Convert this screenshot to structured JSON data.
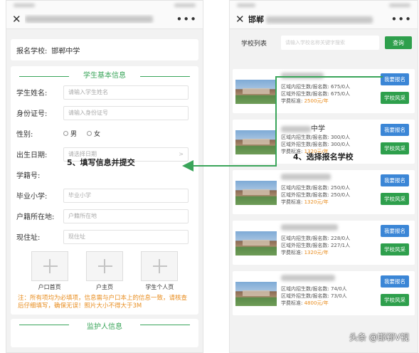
{
  "left_phone": {
    "titlebar": {
      "close_icon": "✕",
      "more_icon": "•••"
    },
    "school_row": {
      "label": "报名学校:",
      "value": "邯郸中学"
    },
    "basic_section_title": "学生基本信息",
    "fields": [
      {
        "label": "学生姓名:",
        "placeholder": "请输入学生姓名"
      },
      {
        "label": "身份证号:",
        "placeholder": "请输入身份证号"
      }
    ],
    "gender": {
      "label": "性别:",
      "options": [
        "男",
        "女"
      ]
    },
    "fields2": [
      {
        "label": "出生日期:",
        "placeholder": "请选择日期"
      },
      {
        "label": "学籍号:",
        "placeholder": ""
      },
      {
        "label": "毕业小学:",
        "placeholder": "毕业小学"
      },
      {
        "label": "户籍所在地:",
        "placeholder": "户籍所在地"
      },
      {
        "label": "现住址:",
        "placeholder": "现住址"
      }
    ],
    "uploads": [
      "户口首页",
      "户主页",
      "学生个人页"
    ],
    "notice": "注：所有项均为必填项，信息需与户口本上的信息一致，请核查后仔细填写，确保无误！照片大小不得大于3M",
    "guardian_section_title": "监护人信息"
  },
  "right_phone": {
    "titlebar": {
      "close_icon": "✕",
      "title_prefix": "邯郸",
      "more_icon": "•••"
    },
    "search": {
      "label": "学校列表",
      "placeholder": "请输入学校名称关键字搜索",
      "button": "查询"
    },
    "labels": {
      "local": "区域内招生数/报名数:",
      "outside": "区域外招生数/报名数:",
      "fee": "学费标准:"
    },
    "buttons": {
      "apply": "我要报名",
      "style": "学校风采"
    },
    "schools": [
      {
        "name": "",
        "local": "675/0人",
        "outside": "675/0人",
        "fee": "2500元/年"
      },
      {
        "name": "中学",
        "local": "300/0人",
        "outside": "300/0人",
        "fee": "1320元/年"
      },
      {
        "name": "",
        "local": "250/0人",
        "outside": "250/0人",
        "fee": "1320元/年"
      },
      {
        "name": "",
        "local": "228/0人",
        "outside": "227/1人",
        "fee": "1320元/年"
      },
      {
        "name": "",
        "local": "74/0人",
        "outside": "73/0人",
        "fee": "4800元/年"
      }
    ]
  },
  "annotations": {
    "step5": "5、填写信息并提交",
    "step4": "4、选择报名学校"
  },
  "watermark": "头条 @邯郸V视",
  "colors": {
    "green": "#3aa55a",
    "blue": "#3b86d6",
    "orange": "#e88d1f"
  }
}
